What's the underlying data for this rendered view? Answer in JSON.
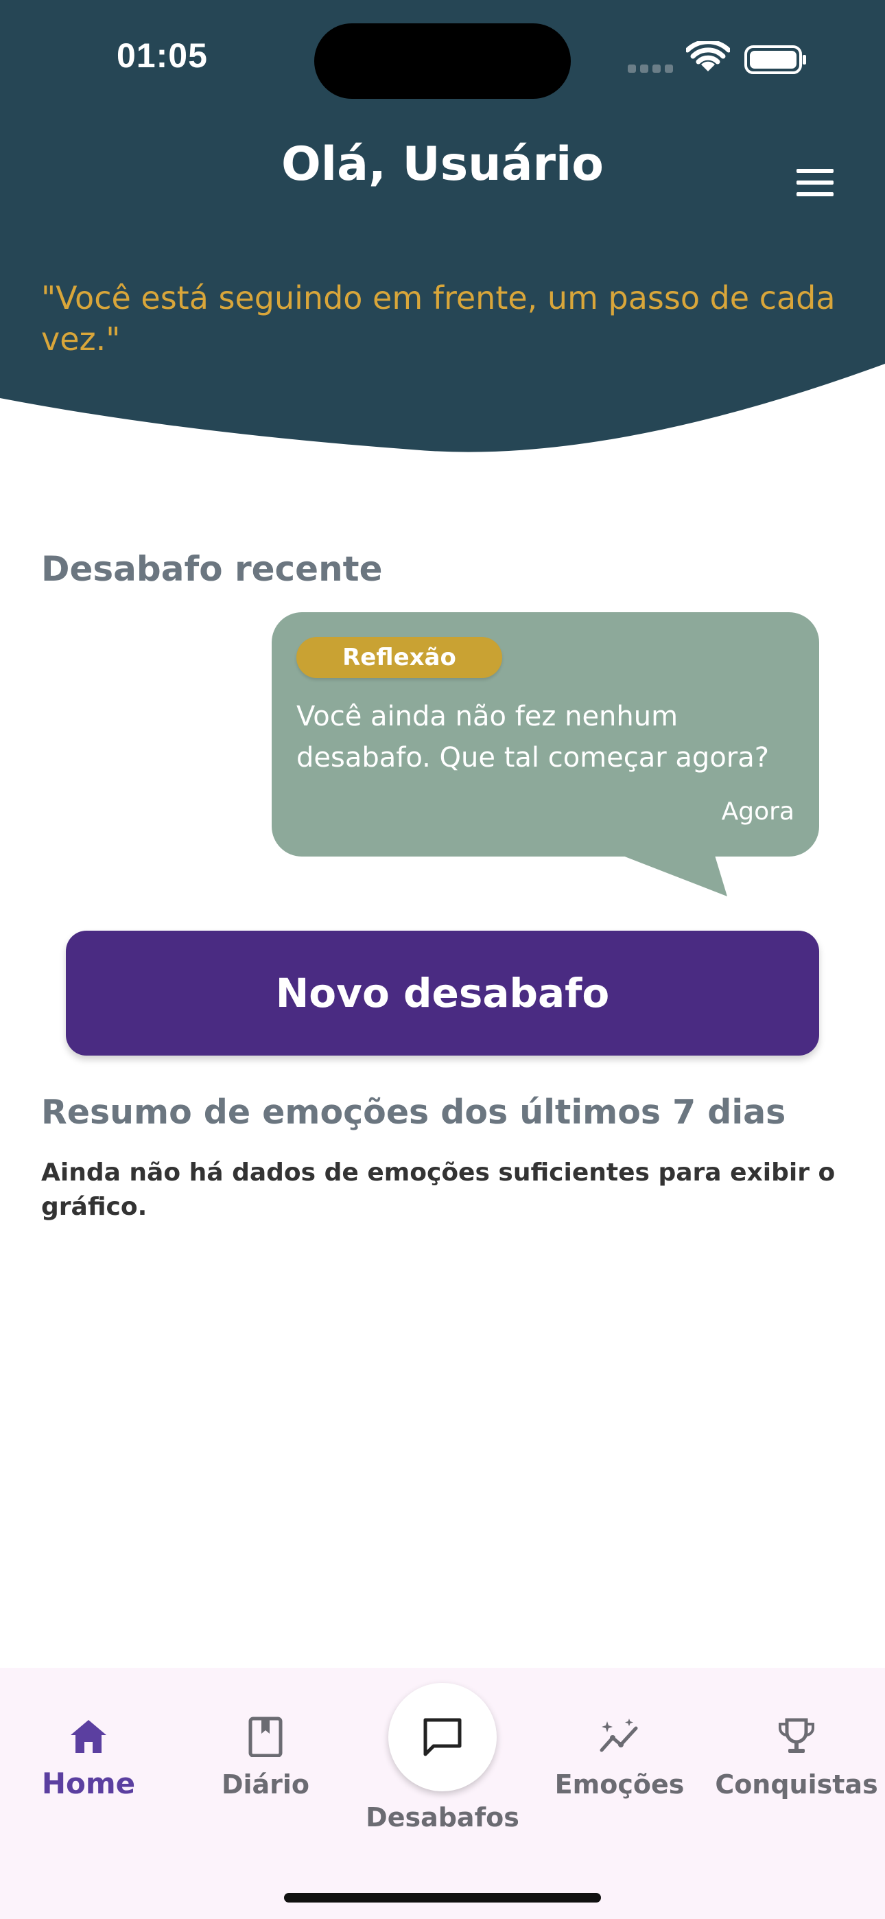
{
  "status_bar": {
    "time": "01:05"
  },
  "header": {
    "title": "Olá, Usuário",
    "quote": "\"Você está seguindo em frente, um passo de cada vez.\""
  },
  "recent": {
    "section_title": "Desabafo recente",
    "tag": "Reflexão",
    "message": "Você ainda não fez nenhum desabafo. Que tal começar agora?",
    "time": "Agora"
  },
  "actions": {
    "new_button": "Novo desabafo"
  },
  "emotions_summary": {
    "section_title": "Resumo de emoções dos últimos 7 dias",
    "empty_message": "Ainda não há dados de emoções suficientes para exibir o gráfico."
  },
  "bottom_nav": {
    "items": [
      {
        "label": "Home",
        "icon": "home-icon",
        "active": true
      },
      {
        "label": "Diário",
        "icon": "book-icon",
        "active": false
      },
      {
        "label": "Desabafos",
        "icon": "chat-bubble-icon",
        "active": false
      },
      {
        "label": "Emoções",
        "icon": "sparkle-chart-icon",
        "active": false
      },
      {
        "label": "Conquistas",
        "icon": "trophy-icon",
        "active": false
      }
    ]
  },
  "colors": {
    "header_bg": "#264655",
    "quote": "#d9a63a",
    "bubble": "#8da99a",
    "tag": "#c9a233",
    "primary_button": "#4a2b82",
    "nav_active": "#5b3fa0",
    "nav_bg": "#fcf3fb"
  }
}
